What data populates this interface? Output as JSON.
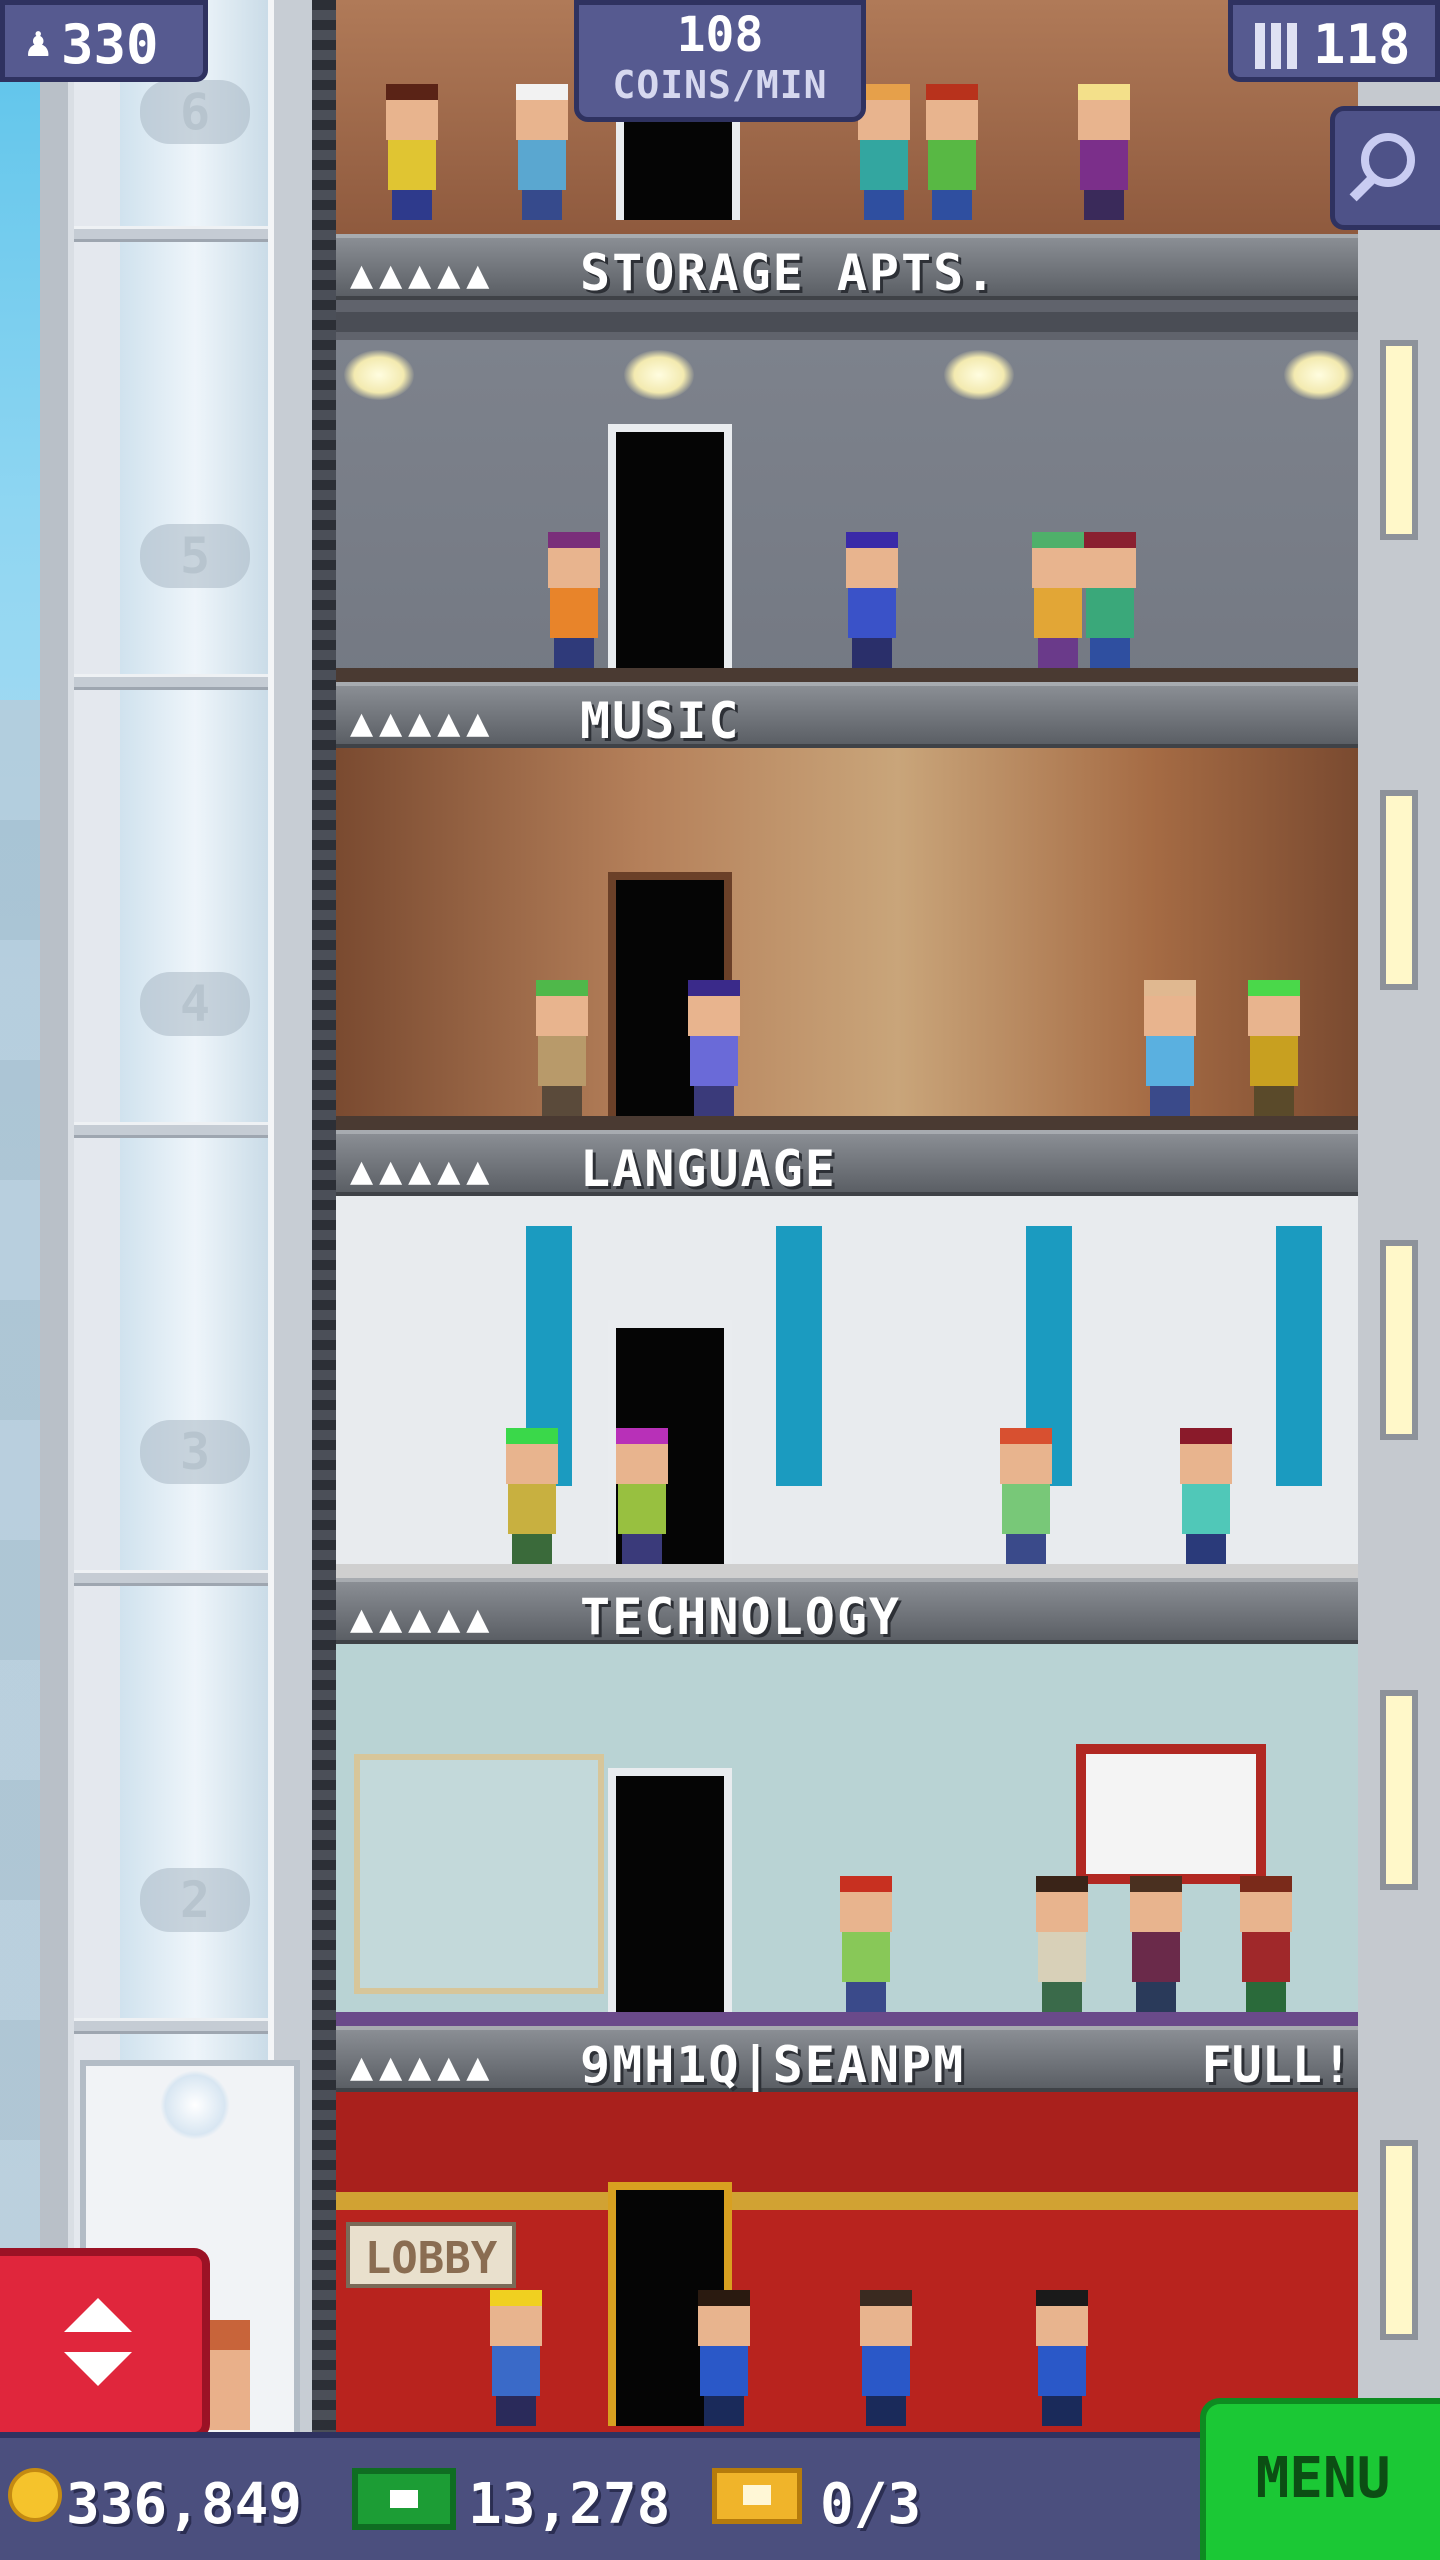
{
  "hud": {
    "population": "330",
    "coins_rate": "108",
    "coins_rate_label": "COINS/MIN",
    "floors": "118"
  },
  "shaft": {
    "floor_numbers": [
      "6",
      "5",
      "4",
      "3",
      "2"
    ]
  },
  "floors": [
    {
      "name": "STORAGE APTS.",
      "pips": "▲▲▲▲▲",
      "status": ""
    },
    {
      "name": "MUSIC",
      "pips": "▲▲▲▲▲",
      "status": ""
    },
    {
      "name": "LANGUAGE",
      "pips": "▲▲▲▲▲",
      "status": ""
    },
    {
      "name": "TECHNOLOGY",
      "pips": "▲▲▲▲▲",
      "status": ""
    },
    {
      "name": "9MH1Q|SEANPM",
      "pips": "▲▲▲▲▲",
      "status": "FULL!"
    }
  ],
  "lobby_sign": "LOBBY",
  "resources": {
    "coins": "336,849",
    "bux": "13,278",
    "tickets": "0/3"
  },
  "menu_label": "MENU",
  "colors": {
    "hud_panel": "#565a90",
    "menu_green": "#1bc835",
    "elevator_red": "#e0263c",
    "coin_gold": "#f5c32c",
    "bux_green": "#1c9d35"
  }
}
